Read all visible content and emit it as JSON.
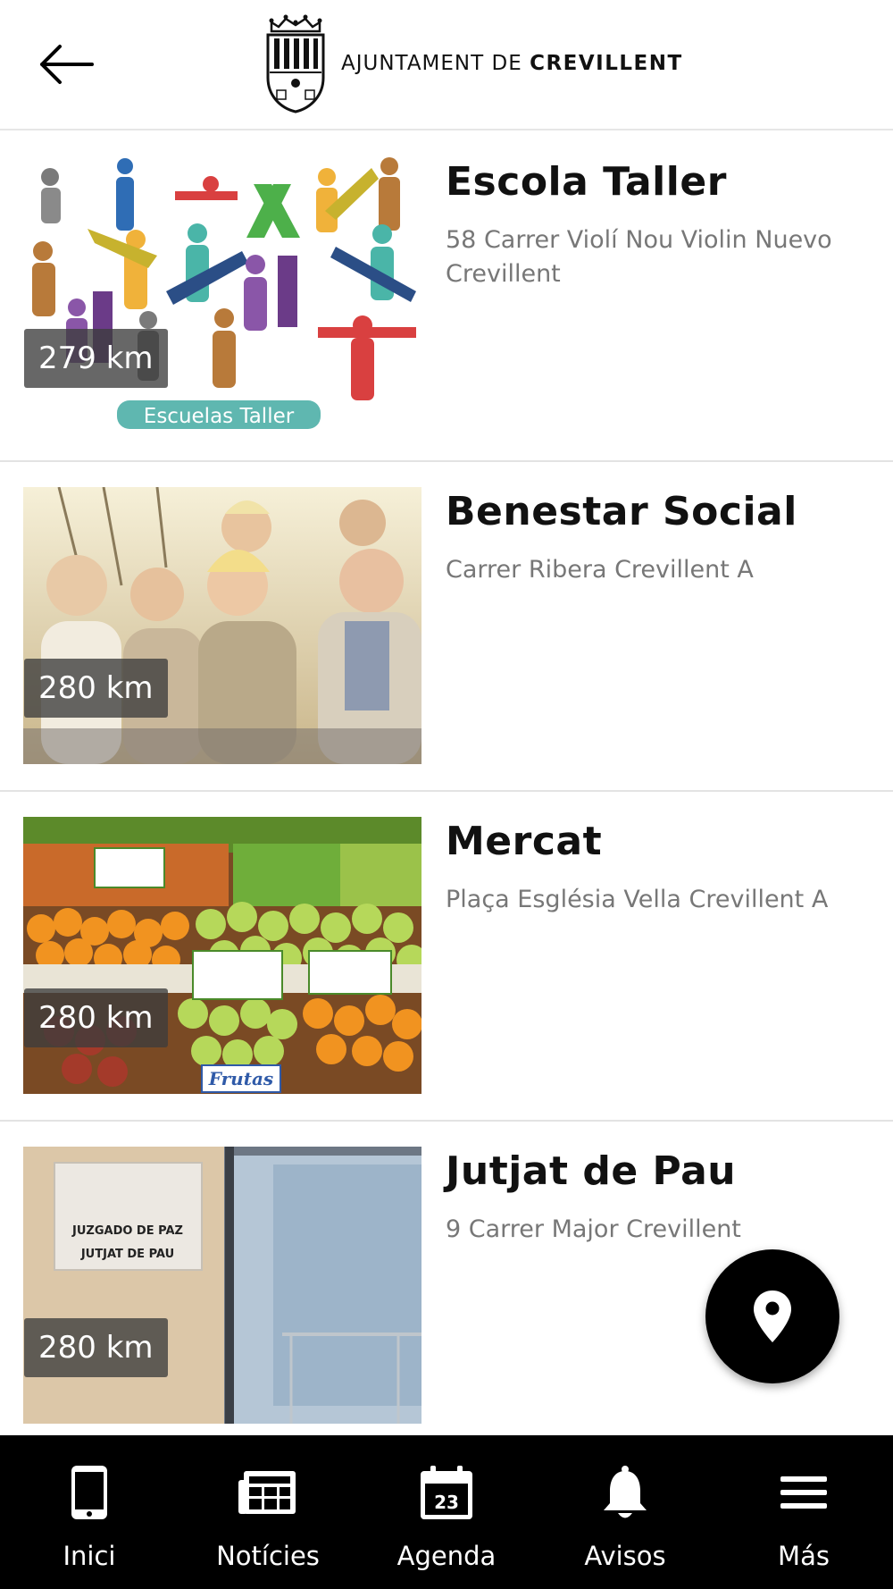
{
  "header": {
    "back_label": "Back",
    "logo_text_light": "AJUNTAMENT DE",
    "logo_text_strong": "CREVILLENT"
  },
  "items": [
    {
      "title": "Escola Taller",
      "address": "58 Carrer Violí Nou Violin Nuevo Crevillent",
      "distance": "279 km",
      "image_caption": "Escuelas Taller"
    },
    {
      "title": "Benestar Social",
      "address": "Carrer Ribera Crevillent A",
      "distance": "280 km"
    },
    {
      "title": "Mercat",
      "address": "Plaça Església Vella Crevillent A",
      "distance": "280 km",
      "image_caption": "Frutas"
    },
    {
      "title": "Jutjat de Pau",
      "address": "9 Carrer Major Crevillent",
      "distance": "280 km",
      "image_caption_1": "JUZGADO DE PAZ",
      "image_caption_2": "JUTJAT DE PAU"
    }
  ],
  "fab": {
    "icon": "map-pin-icon"
  },
  "nav": [
    {
      "label": "Inici",
      "icon": "phone-icon"
    },
    {
      "label": "Notícies",
      "icon": "newspaper-icon"
    },
    {
      "label": "Agenda",
      "icon": "calendar-icon",
      "icon_text": "23"
    },
    {
      "label": "Avisos",
      "icon": "bell-icon"
    },
    {
      "label": "Más",
      "icon": "menu-icon"
    }
  ]
}
